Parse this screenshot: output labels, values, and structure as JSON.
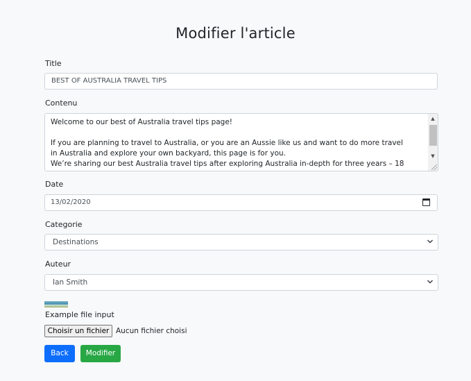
{
  "page": {
    "title": "Modifier l'article"
  },
  "form": {
    "title_label": "Title",
    "title_value": "BEST OF AUSTRALIA TRAVEL TIPS",
    "contenu_label": "Contenu",
    "contenu_value": "Welcome to our best of Australia travel tips page!\n\nIf you are planning to travel to Australia, or you are an Aussie like us and want to do more travel in Australia and explore your own backyard, this page is for you.\nWe’re sharing our best Australia travel tips after exploring Australia in-depth for three years – 18",
    "date_label": "Date",
    "date_value": "13/02/2020",
    "categorie_label": "Categorie",
    "categorie_value": "Destinations",
    "auteur_label": "Auteur",
    "auteur_value": "Ian Smith",
    "file_label": "Example file input",
    "file_button_label": "Choisir un fichier",
    "file_status": "Aucun fichier choisi"
  },
  "actions": {
    "back_label": "Back",
    "modifier_label": "Modifier"
  },
  "icons": {
    "date": "calendar-icon",
    "select": "chevron-down-icon",
    "scroll_up": "arrow-up-icon",
    "scroll_down": "arrow-down-icon"
  },
  "colors": {
    "primary": "#0d6efd",
    "success": "#28a745",
    "background": "#f8f9fa"
  }
}
